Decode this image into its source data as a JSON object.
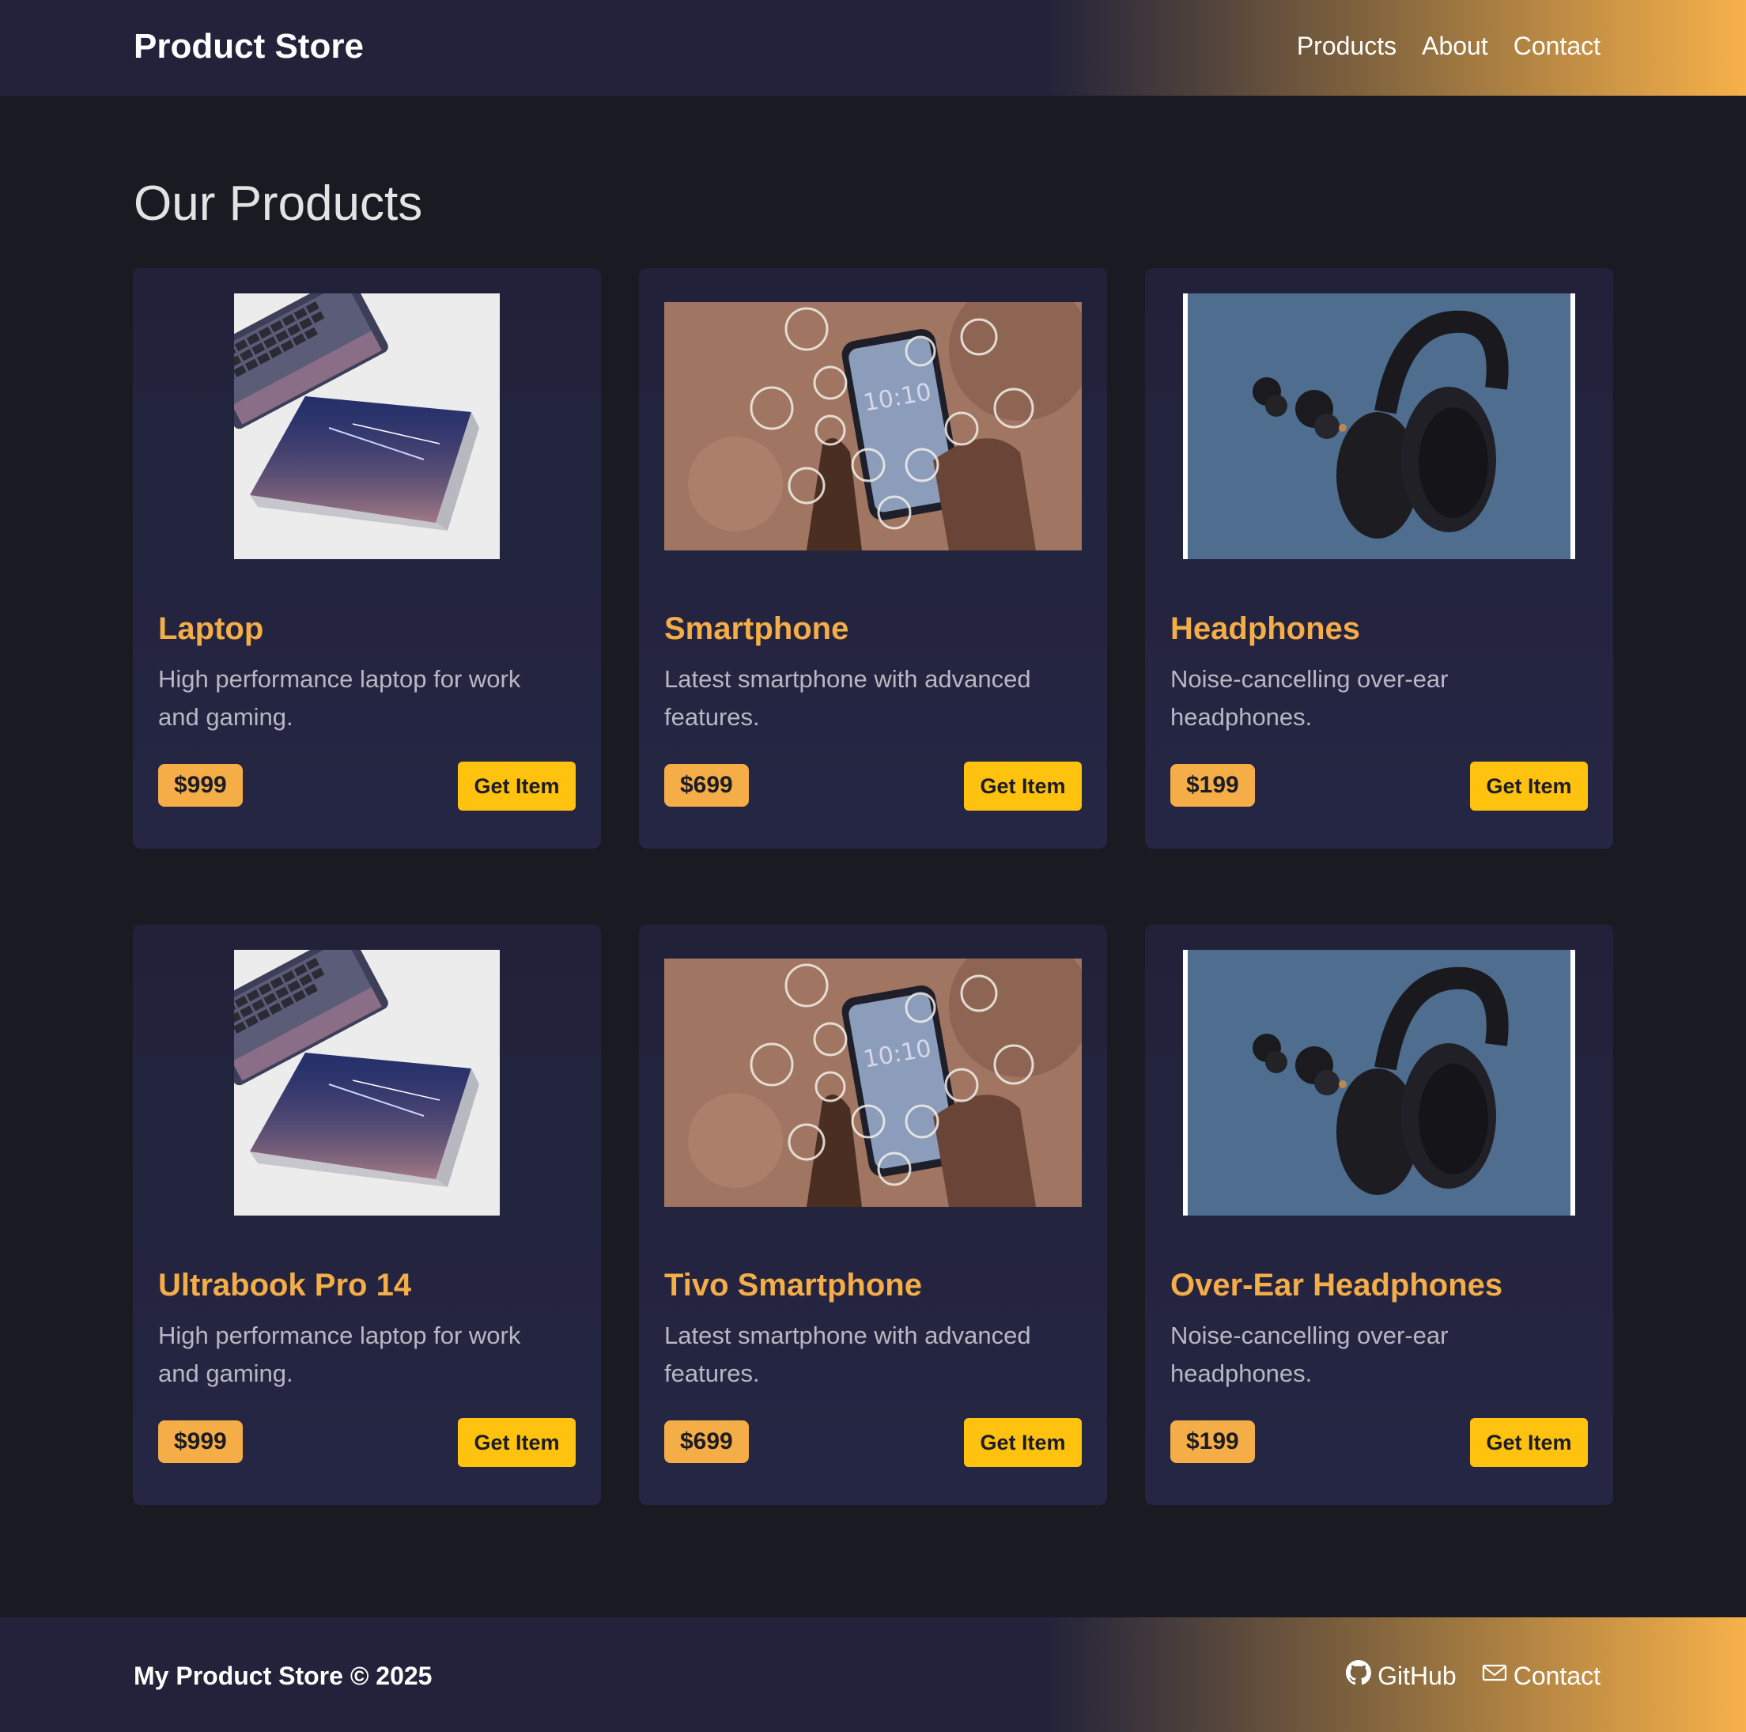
{
  "header": {
    "brand": "Product Store",
    "nav": [
      "Products",
      "About",
      "Contact"
    ]
  },
  "main": {
    "title": "Our Products",
    "products": [
      {
        "name": "Laptop",
        "desc": "High performance laptop for work and gaming.",
        "price": "$999",
        "button": "Get Item",
        "image": "laptop-image"
      },
      {
        "name": "Smartphone",
        "desc": "Latest smartphone with advanced features.",
        "price": "$699",
        "button": "Get Item",
        "image": "smartphone-image"
      },
      {
        "name": "Headphones",
        "desc": "Noise-cancelling over-ear headphones.",
        "price": "$199",
        "button": "Get Item",
        "image": "headphones-image"
      },
      {
        "name": "Ultrabook Pro 14",
        "desc": "High performance laptop for work and gaming.",
        "price": "$999",
        "button": "Get Item",
        "image": "laptop-image"
      },
      {
        "name": "Tivo Smartphone",
        "desc": "Latest smartphone with advanced features.",
        "price": "$699",
        "button": "Get Item",
        "image": "smartphone-image"
      },
      {
        "name": "Over-Ear Headphones",
        "desc": "Noise-cancelling over-ear headphones.",
        "price": "$199",
        "button": "Get Item",
        "image": "headphones-image"
      }
    ]
  },
  "footer": {
    "text": "My Product Store © 2025",
    "links": [
      {
        "label": "GitHub",
        "icon": "github-icon"
      },
      {
        "label": "Contact",
        "icon": "mail-icon"
      }
    ]
  },
  "colors": {
    "accent": "#f5ad47",
    "button": "#ffc20e",
    "background": "#1a1b22",
    "card": "#22233a"
  }
}
